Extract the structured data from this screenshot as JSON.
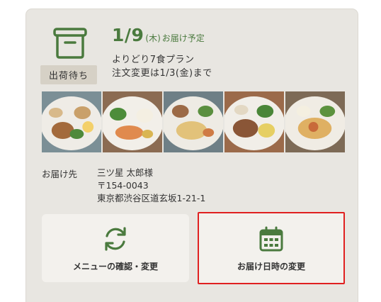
{
  "order": {
    "status_tag": "出荷待ち",
    "delivery_date": "1/9",
    "delivery_weekday": "(木)",
    "delivery_suffix": "お届け予定",
    "plan_name": "よりどり7食プラン",
    "change_deadline": "注文変更は1/3(金)まで"
  },
  "delivery_address": {
    "label": "お届け先",
    "name": "三ツ星 太郎様",
    "postal": "〒154-0043",
    "address": "東京都渋谷区道玄坂1-21-1"
  },
  "actions": {
    "menu_button_label": "メニューの確認・変更",
    "delivery_button_label": "お届け日時の変更"
  },
  "meal_photos": [
    "meal-photo-1",
    "meal-photo-2",
    "meal-photo-3",
    "meal-photo-4",
    "meal-photo-5"
  ],
  "colors": {
    "accent_green": "#4a7a3e",
    "highlight_border": "#e02020",
    "card_background": "#e8e6e1",
    "status_tag_background": "#d6d1c6"
  },
  "icons": {
    "status": "box-icon",
    "menu_button": "refresh-icon",
    "delivery_button": "calendar-icon"
  }
}
